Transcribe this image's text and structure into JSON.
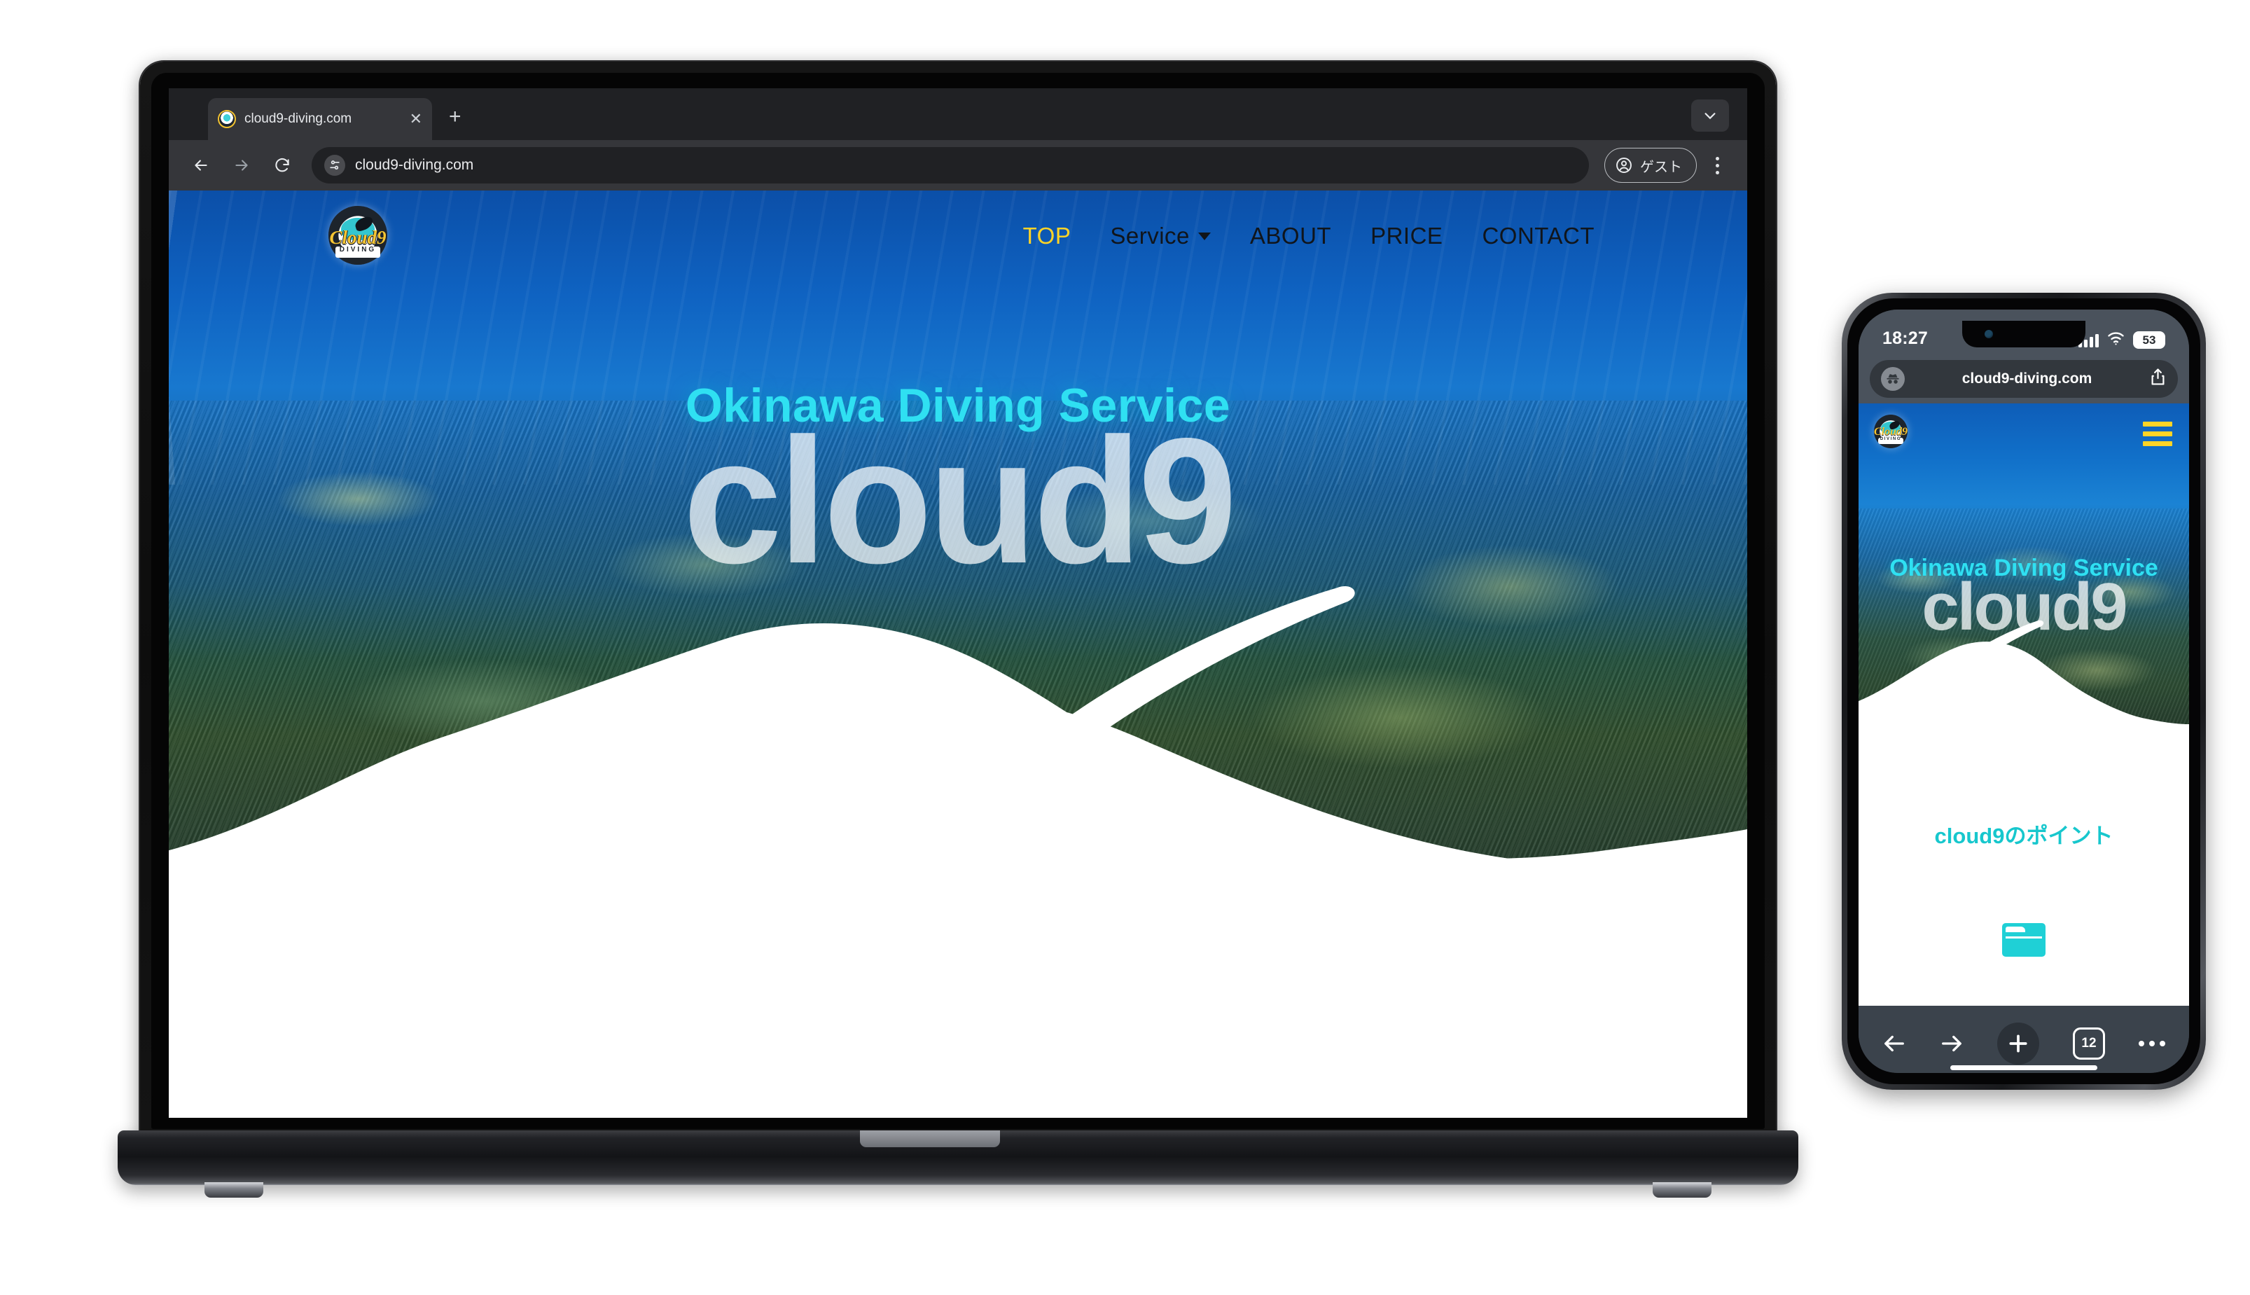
{
  "browser": {
    "tab": {
      "title": "cloud9-diving.com",
      "close_label": "✕"
    },
    "new_tab_label": "+",
    "omnibox": {
      "url": "cloud9-diving.com"
    },
    "guest_label": "ゲスト"
  },
  "site": {
    "logo": {
      "script": "Cloud9",
      "banner": "DIVING"
    },
    "nav": [
      {
        "label": "TOP",
        "active": true,
        "has_menu": false
      },
      {
        "label": "Service",
        "active": false,
        "has_menu": true
      },
      {
        "label": "ABOUT",
        "active": false,
        "has_menu": false
      },
      {
        "label": "PRICE",
        "active": false,
        "has_menu": false
      },
      {
        "label": "CONTACT",
        "active": false,
        "has_menu": false
      }
    ],
    "hero": {
      "subtitle": "Okinawa Diving Service",
      "title": "cloud9"
    },
    "section_heading": "cloud9のポイント",
    "colors": {
      "accent_yellow": "#ffd426",
      "accent_cyan": "#2fe0f2",
      "teal": "#17c7cd"
    }
  },
  "phone": {
    "status": {
      "time": "18:27",
      "battery": "53"
    },
    "urlbar": {
      "url": "cloud9-diving.com"
    },
    "toolbar": {
      "tab_count": "12"
    }
  }
}
